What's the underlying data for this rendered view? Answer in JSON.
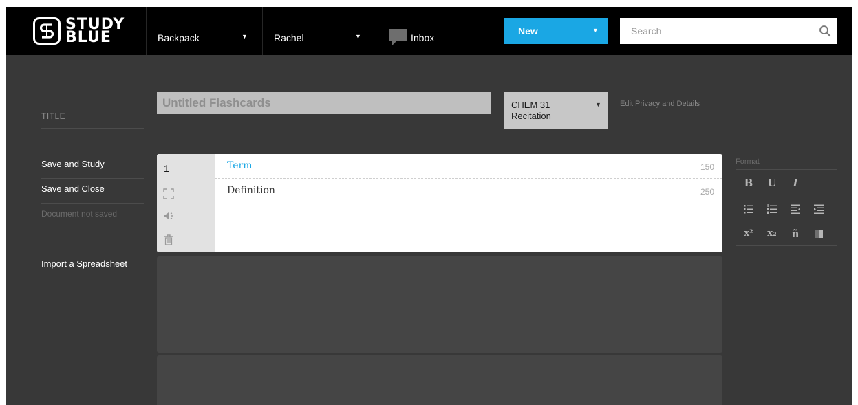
{
  "brand": {
    "line1": "STUDY",
    "line2": "BLUE"
  },
  "nav": {
    "backpack_label": "Backpack",
    "user_label": "Rachel",
    "inbox_label": "Inbox",
    "new_label": "New",
    "search_placeholder": "Search"
  },
  "editor": {
    "title_label": "TITLE",
    "title_placeholder": "Untitled Flashcards",
    "class_label": "CHEM 31 Recitation",
    "privacy_link": "Edit Privacy and Details"
  },
  "sidebar": {
    "save_study": "Save and Study",
    "save_close": "Save and Close",
    "status": "Document not saved",
    "import": "Import a Spreadsheet"
  },
  "card": {
    "number": "1",
    "term_label": "Term",
    "term_count": "150",
    "definition_label": "Definition",
    "definition_count": "250"
  },
  "format": {
    "label": "Format",
    "bold": "B",
    "underline": "U",
    "italic": "I",
    "superscript": "x²",
    "subscript": "x₂",
    "special_char": "ñ"
  },
  "colors": {
    "accent": "#1aa7e4",
    "topbar": "#000000",
    "background": "#383838"
  },
  "icons": [
    "search-icon",
    "inbox-icon",
    "expand-icon",
    "audio-icon",
    "trash-icon",
    "bullet-list-icon",
    "numbered-list-icon",
    "outdent-icon",
    "indent-icon",
    "highlight-icon"
  ]
}
